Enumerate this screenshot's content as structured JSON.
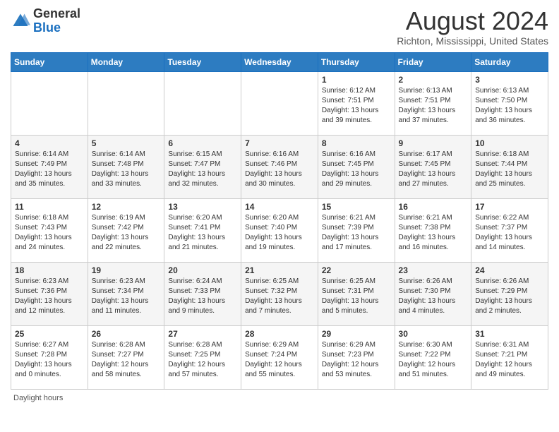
{
  "logo": {
    "general": "General",
    "blue": "Blue"
  },
  "title": "August 2024",
  "subtitle": "Richton, Mississippi, United States",
  "days_of_week": [
    "Sunday",
    "Monday",
    "Tuesday",
    "Wednesday",
    "Thursday",
    "Friday",
    "Saturday"
  ],
  "weeks": [
    [
      {
        "day": "",
        "info": ""
      },
      {
        "day": "",
        "info": ""
      },
      {
        "day": "",
        "info": ""
      },
      {
        "day": "",
        "info": ""
      },
      {
        "day": "1",
        "info": "Sunrise: 6:12 AM\nSunset: 7:51 PM\nDaylight: 13 hours and 39 minutes."
      },
      {
        "day": "2",
        "info": "Sunrise: 6:13 AM\nSunset: 7:51 PM\nDaylight: 13 hours and 37 minutes."
      },
      {
        "day": "3",
        "info": "Sunrise: 6:13 AM\nSunset: 7:50 PM\nDaylight: 13 hours and 36 minutes."
      }
    ],
    [
      {
        "day": "4",
        "info": "Sunrise: 6:14 AM\nSunset: 7:49 PM\nDaylight: 13 hours and 35 minutes."
      },
      {
        "day": "5",
        "info": "Sunrise: 6:14 AM\nSunset: 7:48 PM\nDaylight: 13 hours and 33 minutes."
      },
      {
        "day": "6",
        "info": "Sunrise: 6:15 AM\nSunset: 7:47 PM\nDaylight: 13 hours and 32 minutes."
      },
      {
        "day": "7",
        "info": "Sunrise: 6:16 AM\nSunset: 7:46 PM\nDaylight: 13 hours and 30 minutes."
      },
      {
        "day": "8",
        "info": "Sunrise: 6:16 AM\nSunset: 7:45 PM\nDaylight: 13 hours and 29 minutes."
      },
      {
        "day": "9",
        "info": "Sunrise: 6:17 AM\nSunset: 7:45 PM\nDaylight: 13 hours and 27 minutes."
      },
      {
        "day": "10",
        "info": "Sunrise: 6:18 AM\nSunset: 7:44 PM\nDaylight: 13 hours and 25 minutes."
      }
    ],
    [
      {
        "day": "11",
        "info": "Sunrise: 6:18 AM\nSunset: 7:43 PM\nDaylight: 13 hours and 24 minutes."
      },
      {
        "day": "12",
        "info": "Sunrise: 6:19 AM\nSunset: 7:42 PM\nDaylight: 13 hours and 22 minutes."
      },
      {
        "day": "13",
        "info": "Sunrise: 6:20 AM\nSunset: 7:41 PM\nDaylight: 13 hours and 21 minutes."
      },
      {
        "day": "14",
        "info": "Sunrise: 6:20 AM\nSunset: 7:40 PM\nDaylight: 13 hours and 19 minutes."
      },
      {
        "day": "15",
        "info": "Sunrise: 6:21 AM\nSunset: 7:39 PM\nDaylight: 13 hours and 17 minutes."
      },
      {
        "day": "16",
        "info": "Sunrise: 6:21 AM\nSunset: 7:38 PM\nDaylight: 13 hours and 16 minutes."
      },
      {
        "day": "17",
        "info": "Sunrise: 6:22 AM\nSunset: 7:37 PM\nDaylight: 13 hours and 14 minutes."
      }
    ],
    [
      {
        "day": "18",
        "info": "Sunrise: 6:23 AM\nSunset: 7:36 PM\nDaylight: 13 hours and 12 minutes."
      },
      {
        "day": "19",
        "info": "Sunrise: 6:23 AM\nSunset: 7:34 PM\nDaylight: 13 hours and 11 minutes."
      },
      {
        "day": "20",
        "info": "Sunrise: 6:24 AM\nSunset: 7:33 PM\nDaylight: 13 hours and 9 minutes."
      },
      {
        "day": "21",
        "info": "Sunrise: 6:25 AM\nSunset: 7:32 PM\nDaylight: 13 hours and 7 minutes."
      },
      {
        "day": "22",
        "info": "Sunrise: 6:25 AM\nSunset: 7:31 PM\nDaylight: 13 hours and 5 minutes."
      },
      {
        "day": "23",
        "info": "Sunrise: 6:26 AM\nSunset: 7:30 PM\nDaylight: 13 hours and 4 minutes."
      },
      {
        "day": "24",
        "info": "Sunrise: 6:26 AM\nSunset: 7:29 PM\nDaylight: 13 hours and 2 minutes."
      }
    ],
    [
      {
        "day": "25",
        "info": "Sunrise: 6:27 AM\nSunset: 7:28 PM\nDaylight: 13 hours and 0 minutes."
      },
      {
        "day": "26",
        "info": "Sunrise: 6:28 AM\nSunset: 7:27 PM\nDaylight: 12 hours and 58 minutes."
      },
      {
        "day": "27",
        "info": "Sunrise: 6:28 AM\nSunset: 7:25 PM\nDaylight: 12 hours and 57 minutes."
      },
      {
        "day": "28",
        "info": "Sunrise: 6:29 AM\nSunset: 7:24 PM\nDaylight: 12 hours and 55 minutes."
      },
      {
        "day": "29",
        "info": "Sunrise: 6:29 AM\nSunset: 7:23 PM\nDaylight: 12 hours and 53 minutes."
      },
      {
        "day": "30",
        "info": "Sunrise: 6:30 AM\nSunset: 7:22 PM\nDaylight: 12 hours and 51 minutes."
      },
      {
        "day": "31",
        "info": "Sunrise: 6:31 AM\nSunset: 7:21 PM\nDaylight: 12 hours and 49 minutes."
      }
    ]
  ],
  "daylight_label": "Daylight hours"
}
